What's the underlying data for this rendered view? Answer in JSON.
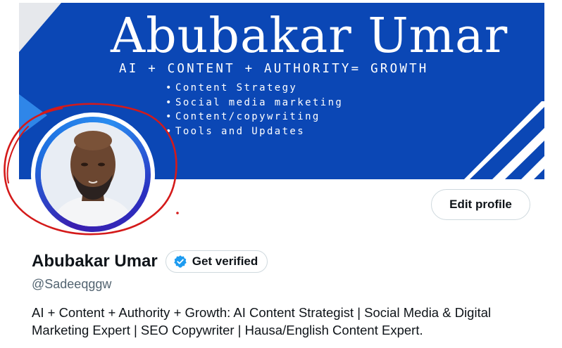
{
  "banner": {
    "title": "Abubakar Umar",
    "tagline": "AI + CONTENT + AUTHORITY= GROWTH",
    "items": [
      {
        "label": "Content Strategy"
      },
      {
        "label": "Social media marketing"
      },
      {
        "label": "Content/copywriting"
      },
      {
        "label": "Tools and Updates"
      }
    ],
    "bullet": "•",
    "colors": {
      "background": "#0b47b5",
      "stripes": "#ffffff",
      "accent_triangle": "#2f86e8"
    }
  },
  "profile": {
    "display_name": "Abubakar Umar",
    "handle": "@Sadeeqggw",
    "bio": "AI + Content + Authority + Growth: AI Content Strategist | Social Media & Digital Marketing Expert | SEO Copywriter | Hausa/English Content Expert.",
    "avatar_icon": "profile-photo",
    "avatar_ring_colors": [
      "#3a1fb0",
      "#1e6fe0",
      "#2a8cf0"
    ],
    "annotation_color": "#d41a1a"
  },
  "actions": {
    "edit_profile_label": "Edit profile",
    "get_verified_label": "Get verified",
    "verified_icon": "verified-badge-icon",
    "verified_icon_color": "#1d9bf0"
  }
}
